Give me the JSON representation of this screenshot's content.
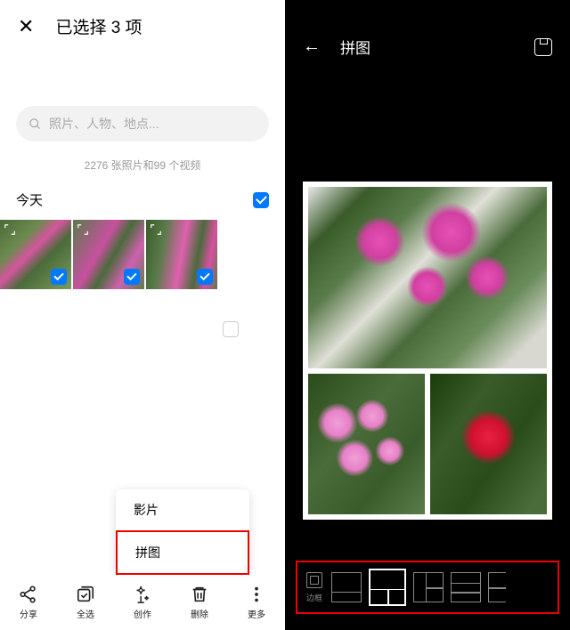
{
  "left": {
    "title": "已选择 3 项",
    "search_placeholder": "照片、人物、地点...",
    "stats": "2276 张照片和99 个视频",
    "section_today": "今天",
    "menu": {
      "item_movie": "影片",
      "item_collage": "拼图"
    },
    "toolbar": {
      "share": "分享",
      "select_all": "全选",
      "create": "创作",
      "delete": "删除",
      "more": "更多"
    }
  },
  "right": {
    "title": "拼图",
    "frame_label": "边框"
  }
}
